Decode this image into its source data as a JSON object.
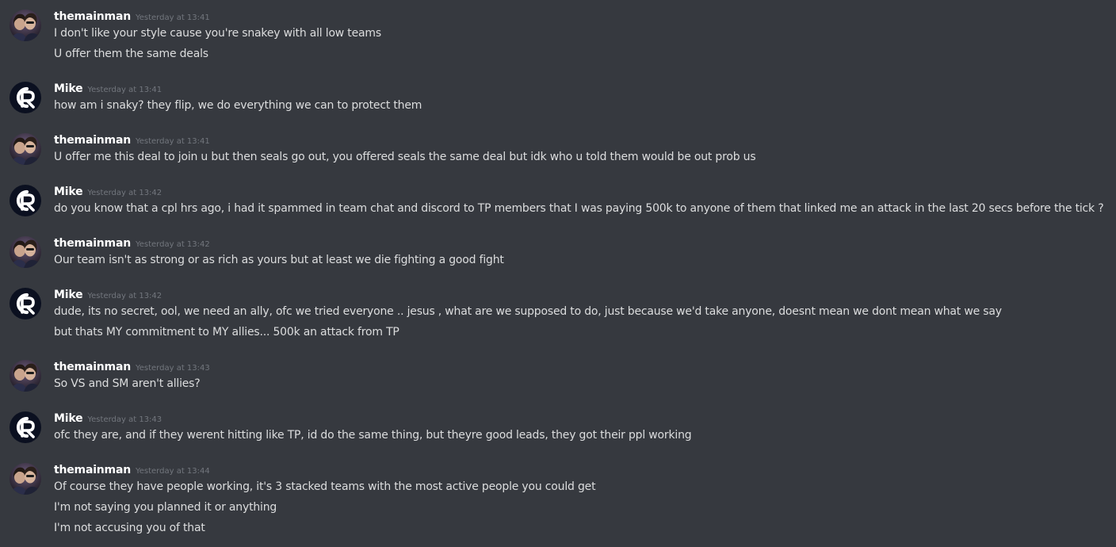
{
  "users": {
    "themainman": {
      "name": "themainman",
      "avatar_icon": "photo-avatar"
    },
    "mike": {
      "name": "Mike",
      "avatar_icon": "cr-logo-avatar"
    }
  },
  "messages": [
    {
      "user": "themainman",
      "timestamp": "Yesterday at 13:41",
      "lines": [
        "I don't like your style cause you're snakey with all low teams",
        "U offer them the same deals"
      ]
    },
    {
      "user": "mike",
      "timestamp": "Yesterday at 13:41",
      "lines": [
        "how am i snaky? they flip, we do everything we can to protect them"
      ]
    },
    {
      "user": "themainman",
      "timestamp": "Yesterday at 13:41",
      "lines": [
        "U offer me this deal to join u but then seals go out, you offered seals the same deal but idk who u told them would be out prob us"
      ]
    },
    {
      "user": "mike",
      "timestamp": "Yesterday at 13:42",
      "lines": [
        "do you know that a cpl hrs ago, i had it spammed in team chat and discord to TP members that I was paying 500k to anyone of them that linked me an attack in the last 20 secs before the tick ?"
      ]
    },
    {
      "user": "themainman",
      "timestamp": "Yesterday at 13:42",
      "lines": [
        "Our team isn't as strong or as rich as yours but at least we die fighting a good fight"
      ]
    },
    {
      "user": "mike",
      "timestamp": "Yesterday at 13:42",
      "lines": [
        "dude, its no secret, ool, we need an ally, ofc we tried everyone .. jesus , what are we supposed to do, just because we'd take anyone, doesnt mean we dont mean what we say",
        "but thats MY commitment to MY allies... 500k an attack from TP"
      ]
    },
    {
      "user": "themainman",
      "timestamp": "Yesterday at 13:43",
      "lines": [
        "So VS and SM aren't allies?"
      ]
    },
    {
      "user": "mike",
      "timestamp": "Yesterday at 13:43",
      "lines": [
        "ofc they are, and if they werent hitting like TP, id do the same thing, but theyre good leads, they got their ppl working"
      ]
    },
    {
      "user": "themainman",
      "timestamp": "Yesterday at 13:44",
      "lines": [
        "Of course they have people working, it's 3 stacked teams with the most active people you could get",
        "I'm not saying you planned it or anything",
        "I'm not accusing you of that"
      ]
    }
  ],
  "colors": {
    "background": "#36393f",
    "username": "#ffffff",
    "message_text": "#dcddde",
    "timestamp": "#72767d",
    "cr_avatar_bg": "#0b1020"
  }
}
